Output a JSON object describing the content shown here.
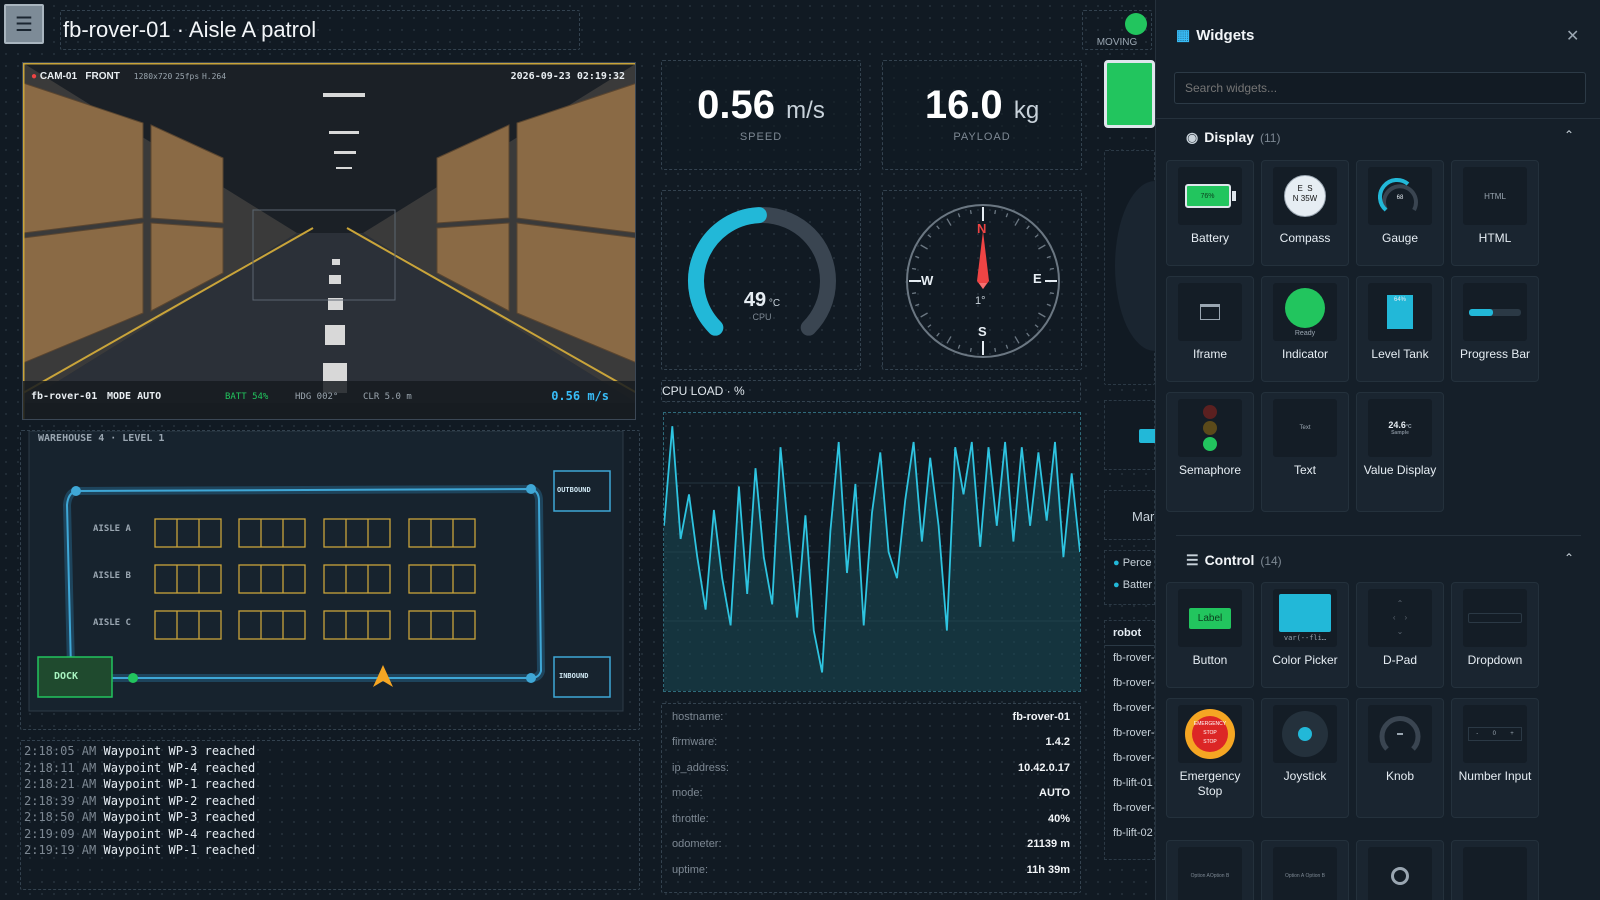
{
  "header": {
    "title": "fb-rover-01 · Aisle A patrol",
    "status": "MOVING"
  },
  "camera": {
    "id": "CAM-01",
    "dir": "FRONT",
    "res": "1280x720",
    "fps": "25fps",
    "codec": "H.264",
    "timestamp": "2026-09-23 02:19:32",
    "robot": "fb-rover-01",
    "mode": "MODE AUTO",
    "batt": "BATT 54%",
    "hdg": "HDG 002°",
    "clr": "CLR 5.0 m",
    "speed": "0.56 m/s"
  },
  "map": {
    "title": "WAREHOUSE 4 · LEVEL 1",
    "aisles": [
      "AISLE A",
      "AISLE B",
      "AISLE C"
    ],
    "outbound": "OUTBOUND",
    "inbound": "INBOUND",
    "dock": "DOCK"
  },
  "log": [
    {
      "t": "2:18:05 AM",
      "m": "Waypoint WP-3 reached"
    },
    {
      "t": "2:18:11 AM",
      "m": "Waypoint WP-4 reached"
    },
    {
      "t": "2:18:21 AM",
      "m": "Waypoint WP-1 reached"
    },
    {
      "t": "2:18:39 AM",
      "m": "Waypoint WP-2 reached"
    },
    {
      "t": "2:18:50 AM",
      "m": "Waypoint WP-3 reached"
    },
    {
      "t": "2:19:09 AM",
      "m": "Waypoint WP-4 reached"
    },
    {
      "t": "2:19:19 AM",
      "m": "Waypoint WP-1 reached"
    }
  ],
  "speed": {
    "value": "0.56",
    "unit": "m/s",
    "label": "SPEED"
  },
  "payload": {
    "value": "16.0",
    "unit": "kg",
    "label": "PAYLOAD"
  },
  "cpu_gauge": {
    "value": "49",
    "unit": "°C",
    "label": "CPU",
    "fraction": 0.49
  },
  "compass": {
    "n": "N",
    "e": "E",
    "s": "S",
    "w": "W",
    "heading": "1°"
  },
  "cpu_load": {
    "title": "CPU LOAD · %",
    "values": [
      60,
      98,
      55,
      72,
      48,
      28,
      66,
      40,
      22,
      75,
      34,
      82,
      48,
      30,
      90,
      56,
      25,
      64,
      20,
      4,
      58,
      92,
      42,
      76,
      22,
      65,
      88,
      50,
      40,
      70,
      92,
      54,
      86,
      60,
      20,
      90,
      72,
      92,
      52,
      90,
      60,
      92,
      54,
      90,
      60,
      88,
      62,
      92,
      48,
      80,
      50
    ]
  },
  "info": [
    {
      "k": "hostname:",
      "v": "fb-rover-01"
    },
    {
      "k": "firmware:",
      "v": "1.4.2"
    },
    {
      "k": "ip_address:",
      "v": "10.42.0.17"
    },
    {
      "k": "mode:",
      "v": "AUTO"
    },
    {
      "k": "throttle:",
      "v": "40%"
    },
    {
      "k": "odometer:",
      "v": "21139 m"
    },
    {
      "k": "uptime:",
      "v": "11h 39m"
    }
  ],
  "strip": {
    "mar": "Mar",
    "legend": [
      "Perce",
      "Batter"
    ],
    "robots_header": "robot",
    "robots": [
      "fb-rover-(",
      "fb-rover-(",
      "fb-rover-(",
      "fb-rover-(",
      "fb-rover-(",
      "fb-lift-01",
      "fb-rover-(",
      "fb-lift-02"
    ]
  },
  "widgets": {
    "title": "Widgets",
    "search_placeholder": "Search widgets...",
    "display": {
      "label": "Display",
      "count": "(11)",
      "items": [
        "Battery",
        "Compass",
        "Gauge",
        "HTML",
        "Iframe",
        "Indicator",
        "Level Tank",
        "Progress Bar",
        "Semaphore",
        "Text",
        "Value Display"
      ]
    },
    "control": {
      "label": "Control",
      "count": "(14)",
      "items": [
        "Button",
        "Color Picker",
        "D-Pad",
        "Dropdown",
        "Emergency Stop",
        "Joystick",
        "Knob",
        "Number Input"
      ]
    },
    "previews": {
      "battery": "76%",
      "compass": "E  S\nN 35W",
      "gauge": "68",
      "html": "HTML",
      "indicator": "Ready",
      "tank": "64%",
      "value": "24.6",
      "value_unit": "°C",
      "value_sub": "Sample",
      "button": "Label",
      "color": "var(--fli…",
      "estop_top": "EMERGENCY",
      "estop_mid": "STOP",
      "estop_bot": "STOP",
      "numinput": "0",
      "opt_a": "Option A",
      "opt_b": "Option B"
    }
  }
}
